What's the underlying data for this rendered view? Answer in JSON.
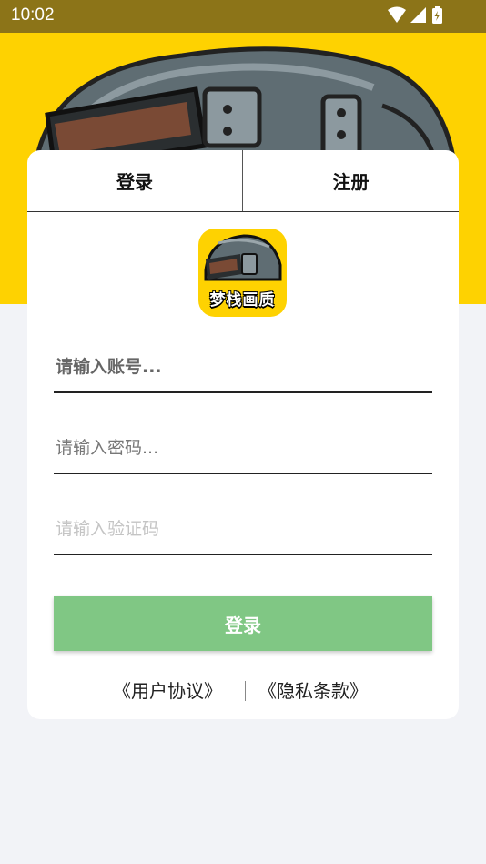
{
  "status_bar": {
    "time": "10:02",
    "icons": [
      "wifi-icon",
      "cellular-signal-icon",
      "battery-charging-icon"
    ]
  },
  "tabs": {
    "login": "登录",
    "register": "注册"
  },
  "app_logo": {
    "text": "梦栈画质"
  },
  "form": {
    "account_placeholder": "请输入账号...",
    "password_placeholder": "请输入密码...",
    "captcha_placeholder": "请输入验证码",
    "submit_label": "登录"
  },
  "footer": {
    "user_agreement": "《用户协议》",
    "privacy_policy": "《隐私条款》"
  },
  "colors": {
    "hero_background": "#fed201",
    "status_bar": "#8c7418",
    "login_button": "#80c784",
    "page_background": "#f2f3f7"
  }
}
